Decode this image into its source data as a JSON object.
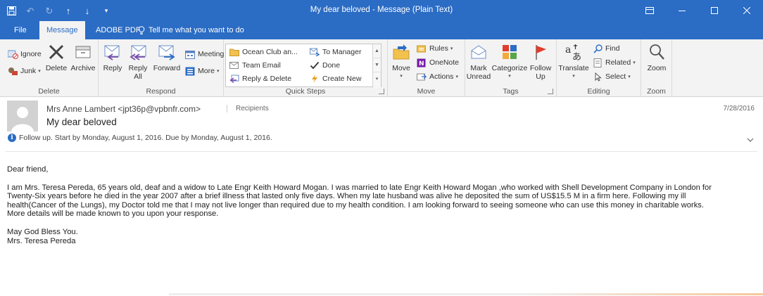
{
  "window": {
    "title": "My dear beloved  -  Message (Plain Text)"
  },
  "tabs": [
    {
      "label": "File"
    },
    {
      "label": "Message"
    },
    {
      "label": "ADOBE PDF"
    }
  ],
  "tell_me": "Tell me what you want to do",
  "ribbon": {
    "delete_group": {
      "label": "Delete",
      "ignore": "Ignore",
      "junk": "Junk",
      "delete": "Delete",
      "archive": "Archive"
    },
    "respond_group": {
      "label": "Respond",
      "reply": "Reply",
      "reply_all": "Reply\nAll",
      "forward": "Forward",
      "meeting": "Meeting",
      "more": "More"
    },
    "quick_steps_group": {
      "label": "Quick Steps",
      "items": [
        "Ocean Club an...",
        "To Manager",
        "Team Email",
        "Done",
        "Reply & Delete",
        "Create New"
      ]
    },
    "move_group": {
      "label": "Move",
      "move": "Move",
      "rules": "Rules",
      "onenote": "OneNote",
      "actions": "Actions"
    },
    "tags_group": {
      "label": "Tags",
      "mark_unread": "Mark\nUnread",
      "categorize": "Categorize",
      "follow_up": "Follow\nUp"
    },
    "editing_group": {
      "label": "Editing",
      "translate": "Translate",
      "find": "Find",
      "related": "Related",
      "select": "Select"
    },
    "zoom_group": {
      "label": "Zoom",
      "zoom": "Zoom"
    }
  },
  "message": {
    "sender": "Mrs Anne Lambert <jpt36p@vpbnfr.com>",
    "recipients": "Recipients",
    "date": "7/28/2016",
    "subject": "My dear beloved",
    "follow_up": "Follow up.  Start by Monday, August 1, 2016.  Due by Monday, August 1, 2016.",
    "body": {
      "greeting": "Dear friend,",
      "paragraph": "I am Mrs. Teresa Pereda, 65 years old, deaf and a widow to Late Engr Keith Howard Mogan. I was married to late Engr Keith Howard Mogan ,who worked with Shell Development Company in London for\nTwenty-Six years before he died in the year 2007 after a brief illness that lasted only five days. When my late husband was alive he deposited the sum of US$15.5 M in a firm here. Following my ill\nhealth(Cancer of the Lungs), my Doctor told me that I may not live longer than required due to my health condition. I am looking forward to seeing someone who can use this money in charitable works.\nMore details will be made known to you upon your response.",
      "closing": "May God Bless You.\nMrs. Teresa Pereda"
    }
  },
  "colors": {
    "accent": "#2b6cc4",
    "ribbon_bg": "#f3f3f3",
    "flag_red": "#e23d2d"
  }
}
